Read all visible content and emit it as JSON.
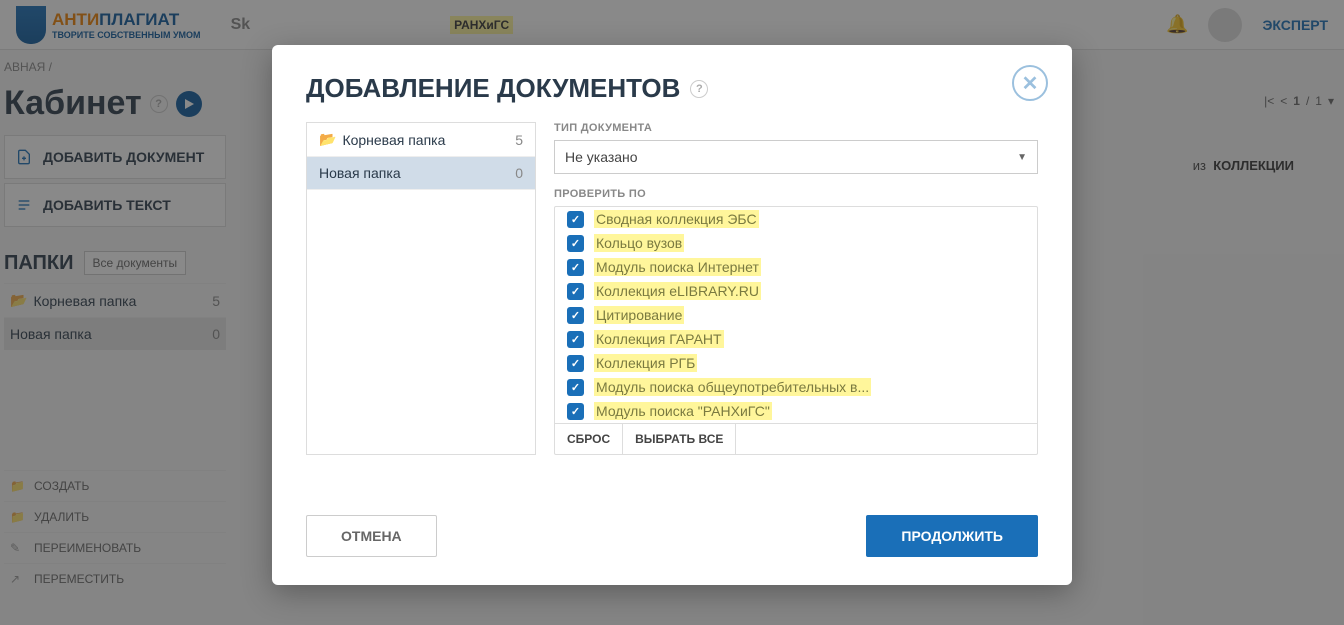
{
  "header": {
    "logo_a": "АНТИ",
    "logo_p": "ПЛАГИАТ",
    "logo_sub": "ТВОРИТЕ СОБСТВЕННЫМ УМОМ",
    "sk": "Sk",
    "org": "РАНХиГС",
    "role": "ЭКСПЕРТ"
  },
  "breadcrumb": "АВНАЯ  /",
  "page_title": "Кабинет",
  "side": {
    "add_doc": "ДОБАВИТЬ ДОКУМЕНТ",
    "add_text": "ДОБАВИТЬ ТЕКСТ",
    "folders_title": "ПАПКИ",
    "all_docs": "Все документы",
    "folders": [
      {
        "name": "Корневая папка",
        "count": "5",
        "root": true,
        "sel": false
      },
      {
        "name": "Новая папка",
        "count": "0",
        "root": false,
        "sel": true
      }
    ],
    "actions": {
      "create": "СОЗДАТЬ",
      "delete": "УДАЛИТЬ",
      "rename": "ПЕРЕИМЕНОВАТЬ",
      "move": "ПЕРЕМЕСТИТЬ"
    }
  },
  "pager": {
    "page": "1",
    "sep": "/",
    "total": "1"
  },
  "content": {
    "from": "из",
    "collections": "КОЛЛЕКЦИИ"
  },
  "modal": {
    "title": "ДОБАВЛЕНИЕ ДОКУМЕНТОВ",
    "folders": [
      {
        "name": "Корневая папка",
        "count": "5",
        "root": true,
        "sel": false
      },
      {
        "name": "Новая папка",
        "count": "0",
        "root": false,
        "sel": true
      }
    ],
    "doctype_label": "ТИП ДОКУМЕНТА",
    "doctype_value": "Не указано",
    "check_label": "ПРОВЕРИТЬ ПО",
    "checks": [
      "Сводная коллекция ЭБС",
      "Кольцо вузов",
      "Модуль поиска Интернет",
      "Коллекция eLIBRARY.RU",
      "Цитирование",
      "Коллекция ГАРАНТ",
      "Коллекция РГБ",
      "Модуль поиска общеупотребительных в...",
      "Модуль поиска \"РАНХиГС\""
    ],
    "reset": "СБРОС",
    "select_all": "ВЫБРАТЬ ВСЕ",
    "cancel": "ОТМЕНА",
    "ok": "ПРОДОЛЖИТЬ"
  }
}
